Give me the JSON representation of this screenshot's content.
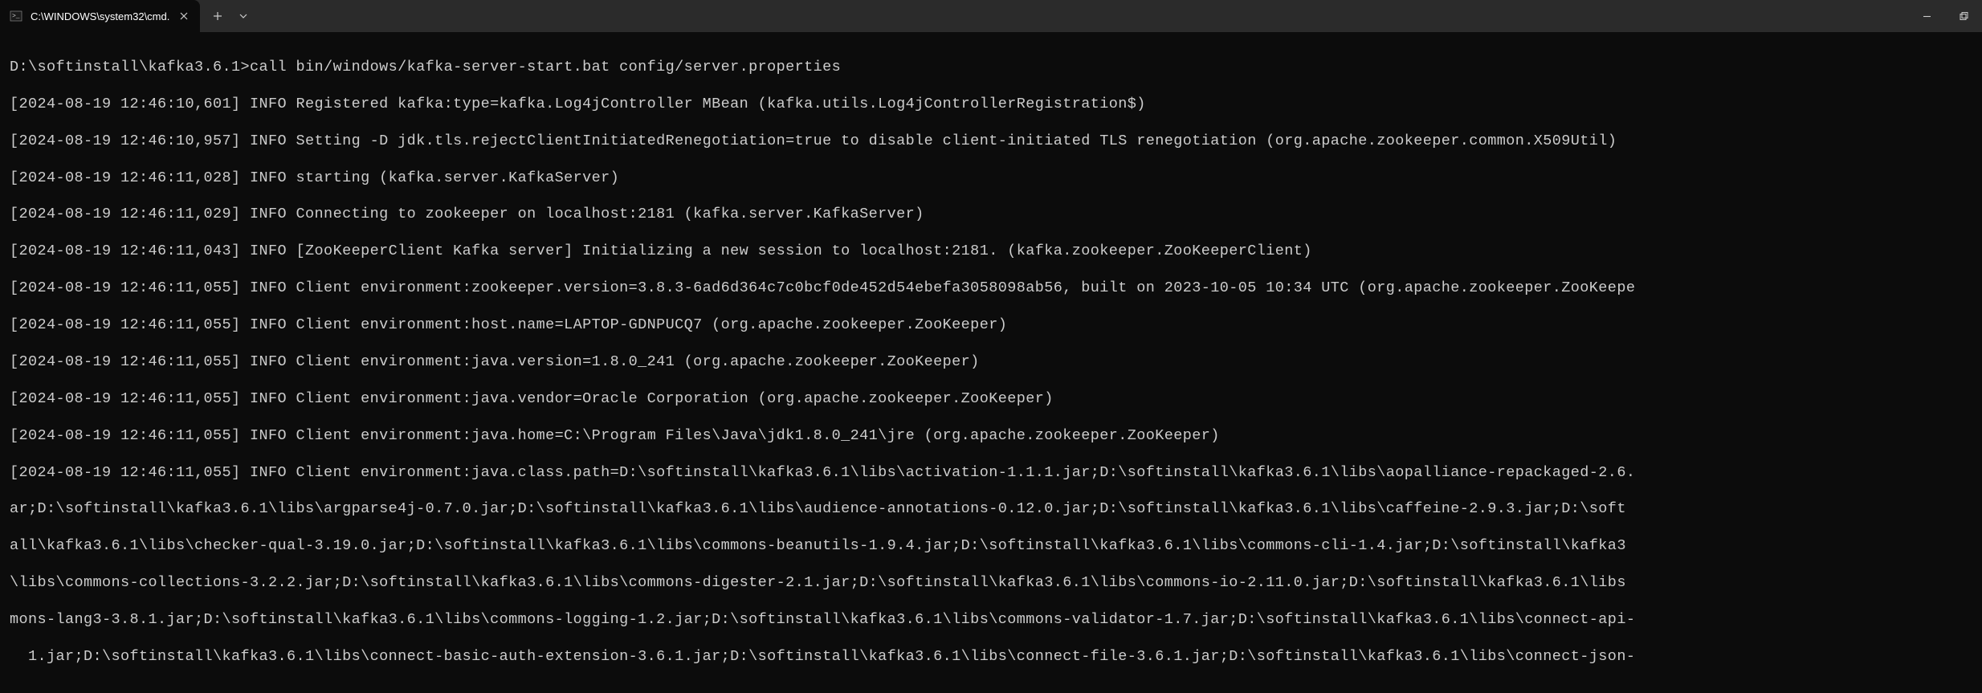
{
  "tab": {
    "title": "C:\\WINDOWS\\system32\\cmd."
  },
  "terminal": {
    "prompt": "D:\\softinstall\\kafka3.6.1>call bin/windows/kafka-server-start.bat config/server.properties",
    "lines": [
      "[2024-08-19 12:46:10,601] INFO Registered kafka:type=kafka.Log4jController MBean (kafka.utils.Log4jControllerRegistration$)",
      "[2024-08-19 12:46:10,957] INFO Setting -D jdk.tls.rejectClientInitiatedRenegotiation=true to disable client-initiated TLS renegotiation (org.apache.zookeeper.common.X509Util)",
      "[2024-08-19 12:46:11,028] INFO starting (kafka.server.KafkaServer)",
      "[2024-08-19 12:46:11,029] INFO Connecting to zookeeper on localhost:2181 (kafka.server.KafkaServer)",
      "[2024-08-19 12:46:11,043] INFO [ZooKeeperClient Kafka server] Initializing a new session to localhost:2181. (kafka.zookeeper.ZooKeeperClient)",
      "[2024-08-19 12:46:11,055] INFO Client environment:zookeeper.version=3.8.3-6ad6d364c7c0bcf0de452d54ebefa3058098ab56, built on 2023-10-05 10:34 UTC (org.apache.zookeeper.ZooKeepe",
      "[2024-08-19 12:46:11,055] INFO Client environment:host.name=LAPTOP-GDNPUCQ7 (org.apache.zookeeper.ZooKeeper)",
      "[2024-08-19 12:46:11,055] INFO Client environment:java.version=1.8.0_241 (org.apache.zookeeper.ZooKeeper)",
      "[2024-08-19 12:46:11,055] INFO Client environment:java.vendor=Oracle Corporation (org.apache.zookeeper.ZooKeeper)",
      "[2024-08-19 12:46:11,055] INFO Client environment:java.home=C:\\Program Files\\Java\\jdk1.8.0_241\\jre (org.apache.zookeeper.ZooKeeper)",
      "[2024-08-19 12:46:11,055] INFO Client environment:java.class.path=D:\\softinstall\\kafka3.6.1\\libs\\activation-1.1.1.jar;D:\\softinstall\\kafka3.6.1\\libs\\aopalliance-repackaged-2.6.",
      "ar;D:\\softinstall\\kafka3.6.1\\libs\\argparse4j-0.7.0.jar;D:\\softinstall\\kafka3.6.1\\libs\\audience-annotations-0.12.0.jar;D:\\softinstall\\kafka3.6.1\\libs\\caffeine-2.9.3.jar;D:\\soft",
      "all\\kafka3.6.1\\libs\\checker-qual-3.19.0.jar;D:\\softinstall\\kafka3.6.1\\libs\\commons-beanutils-1.9.4.jar;D:\\softinstall\\kafka3.6.1\\libs\\commons-cli-1.4.jar;D:\\softinstall\\kafka3",
      "\\libs\\commons-collections-3.2.2.jar;D:\\softinstall\\kafka3.6.1\\libs\\commons-digester-2.1.jar;D:\\softinstall\\kafka3.6.1\\libs\\commons-io-2.11.0.jar;D:\\softinstall\\kafka3.6.1\\libs",
      "mons-lang3-3.8.1.jar;D:\\softinstall\\kafka3.6.1\\libs\\commons-logging-1.2.jar;D:\\softinstall\\kafka3.6.1\\libs\\commons-validator-1.7.jar;D:\\softinstall\\kafka3.6.1\\libs\\connect-api-",
      "  1.jar;D:\\softinstall\\kafka3.6.1\\libs\\connect-basic-auth-extension-3.6.1.jar;D:\\softinstall\\kafka3.6.1\\libs\\connect-file-3.6.1.jar;D:\\softinstall\\kafka3.6.1\\libs\\connect-json-"
    ]
  }
}
